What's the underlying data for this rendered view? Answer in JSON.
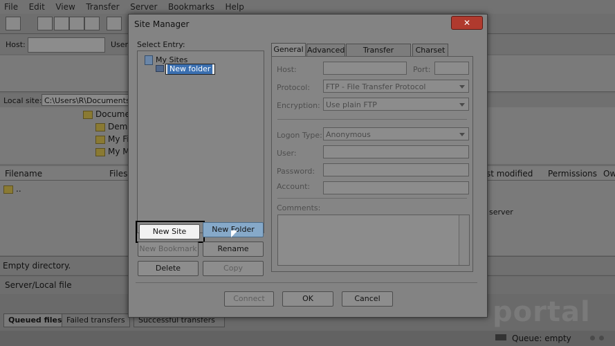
{
  "menu": {
    "items": [
      "File",
      "Edit",
      "View",
      "Transfer",
      "Server",
      "Bookmarks",
      "Help"
    ]
  },
  "quickconnect": {
    "host_label": "Host:",
    "user_label": "Usern"
  },
  "local": {
    "label": "Local site:",
    "path": "C:\\Users\\R\\Documents\\",
    "tree": [
      "Docume",
      "Demo",
      "My Fi",
      "My M"
    ]
  },
  "filelist": {
    "headers": {
      "filename": "Filename",
      "filesize": "Filesi",
      "last_modified": "st modified",
      "permissions": "Permissions",
      "owner": "Ow"
    },
    "rows": [
      ".."
    ],
    "remote_note": "server"
  },
  "status": {
    "empty_dir": "Empty directory.",
    "server_local": "Server/Local file"
  },
  "queue_tabs": [
    "Queued files",
    "Failed transfers",
    "Successful transfers"
  ],
  "statusbar": {
    "queue": "Queue: empty"
  },
  "watermark": "portal",
  "dialog": {
    "title": "Site Manager",
    "close": "✕",
    "select_entry_label": "Select Entry:",
    "tree": {
      "root": "My Sites",
      "editing_item": "New folder"
    },
    "buttons": {
      "new_site": "New Site",
      "new_folder": "New Folder",
      "new_bookmark": "New Bookmark",
      "rename": "Rename",
      "delete": "Delete",
      "copy": "Copy",
      "connect": "Connect",
      "ok": "OK",
      "cancel": "Cancel"
    },
    "tabs": [
      "General",
      "Advanced",
      "Transfer Settings",
      "Charset"
    ],
    "general": {
      "host_label": "Host:",
      "port_label": "Port:",
      "protocol_label": "Protocol:",
      "protocol_value": "FTP - File Transfer Protocol",
      "encryption_label": "Encryption:",
      "encryption_value": "Use plain FTP",
      "logon_label": "Logon Type:",
      "logon_value": "Anonymous",
      "user_label": "User:",
      "password_label": "Password:",
      "account_label": "Account:",
      "comments_label": "Comments:"
    }
  }
}
